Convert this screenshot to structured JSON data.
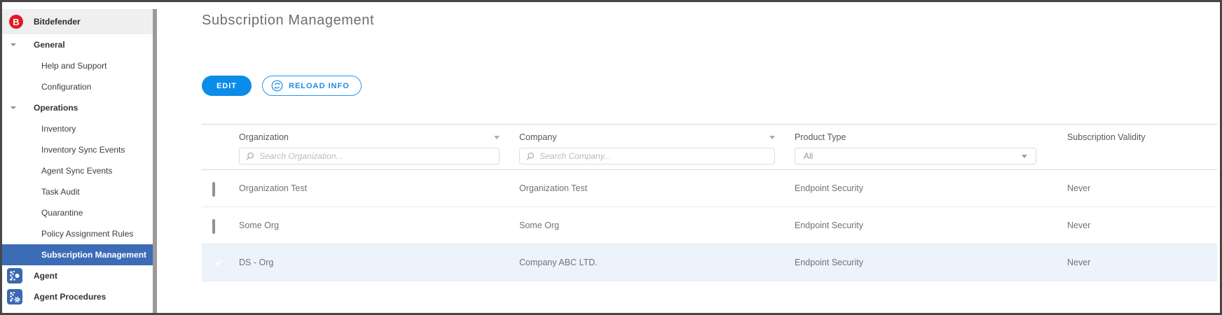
{
  "colors": {
    "accent_blue": "#0a8ce8",
    "reload_blue": "#1b8ce2",
    "sidebar_selected_bg": "#3d6cb7",
    "module_icon_bg": "#3a68b2",
    "logo_red": "#e01b24",
    "checkbox_checked": "#0c74e3",
    "checkbox_indeterminate": "#4aa5f1",
    "selected_row_bg": "#edf3fb"
  },
  "sidebar": {
    "brand": {
      "logo_letter": "B",
      "label": "Bitdefender"
    },
    "items": [
      {
        "label": "General",
        "type": "section",
        "expanded": true
      },
      {
        "label": "Help and Support",
        "type": "sub"
      },
      {
        "label": "Configuration",
        "type": "sub"
      },
      {
        "label": "Operations",
        "type": "section",
        "expanded": true
      },
      {
        "label": "Inventory",
        "type": "sub"
      },
      {
        "label": "Inventory Sync Events",
        "type": "sub"
      },
      {
        "label": "Agent Sync Events",
        "type": "sub"
      },
      {
        "label": "Task Audit",
        "type": "sub"
      },
      {
        "label": "Quarantine",
        "type": "sub"
      },
      {
        "label": "Policy Assignment Rules",
        "type": "sub"
      },
      {
        "label": "Subscription Management",
        "type": "sub",
        "selected": true
      },
      {
        "label": "Agent",
        "type": "module",
        "icon": "agent-icon"
      },
      {
        "label": "Agent Procedures",
        "type": "module",
        "icon": "agent-procedures-icon"
      }
    ]
  },
  "main": {
    "title": "Subscription Management",
    "actions": {
      "edit_label": "EDIT",
      "reload_label": "RELOAD INFO"
    },
    "table": {
      "header_checkbox": "indeterminate",
      "columns": [
        {
          "label": "Organization",
          "sortable": true,
          "search_placeholder": "Search Organization..."
        },
        {
          "label": "Company",
          "sortable": true,
          "search_placeholder": "Search Company..."
        },
        {
          "label": "Product Type",
          "filter_value": "All"
        },
        {
          "label": "Subscription Validity"
        }
      ],
      "rows": [
        {
          "checked": false,
          "selected": false,
          "organization": "Organization Test",
          "company": "Organization Test",
          "product_type": "Endpoint Security",
          "subscription_validity": "Never"
        },
        {
          "checked": false,
          "selected": false,
          "organization": "Some Org",
          "company": "Some Org",
          "product_type": "Endpoint Security",
          "subscription_validity": "Never"
        },
        {
          "checked": true,
          "selected": true,
          "organization": "DS - Org",
          "company": "Company ABC LTD.",
          "product_type": "Endpoint Security",
          "subscription_validity": "Never"
        }
      ]
    }
  }
}
